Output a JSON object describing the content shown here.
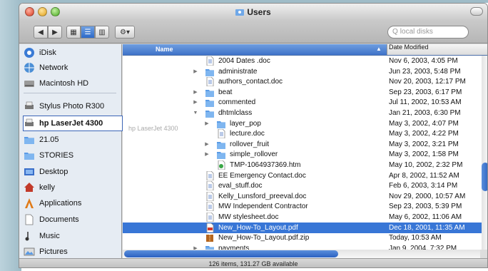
{
  "window": {
    "title": "Users",
    "status_text": "126 items, 131.27 GB available"
  },
  "toolbar": {
    "search_placeholder": "local disks",
    "action_label": "⚙▾"
  },
  "sidebar": {
    "items": [
      {
        "label": "iDisk",
        "icon": "idisk-icon"
      },
      {
        "label": "Network",
        "icon": "network-icon"
      },
      {
        "label": "Macintosh HD",
        "icon": "harddisk-icon"
      },
      {
        "label": "Stylus Photo R300",
        "icon": "printer-icon"
      },
      {
        "label": "hp LaserJet 4300",
        "icon": "printer-icon",
        "selected": true
      },
      {
        "label": "21.05",
        "icon": "folder-icon"
      },
      {
        "label": "STORIES",
        "icon": "folder-icon"
      },
      {
        "label": "Desktop",
        "icon": "desktop-icon"
      },
      {
        "label": "kelly",
        "icon": "home-icon"
      },
      {
        "label": "Applications",
        "icon": "applications-icon"
      },
      {
        "label": "Documents",
        "icon": "documents-icon"
      },
      {
        "label": "Music",
        "icon": "music-icon"
      },
      {
        "label": "Pictures",
        "icon": "pictures-icon"
      }
    ],
    "drag_ghost": "hp LaserJet 4300"
  },
  "list": {
    "headers": {
      "name": "Name",
      "date": "Date Modified"
    },
    "rows": [
      {
        "name": "2004 Dates .doc",
        "date": "Nov 6, 2003, 4:05 PM",
        "kind": "doc",
        "indent": 0,
        "tri": ""
      },
      {
        "name": "administrate",
        "date": "Jun 23, 2003, 5:48 PM",
        "kind": "folder",
        "indent": 0,
        "tri": "▶"
      },
      {
        "name": "authors_contact.doc",
        "date": "Nov 20, 2003, 12:17 PM",
        "kind": "doc",
        "indent": 0,
        "tri": ""
      },
      {
        "name": "beat",
        "date": "Sep 23, 2003, 6:17 PM",
        "kind": "folder",
        "indent": 0,
        "tri": "▶"
      },
      {
        "name": "commented",
        "date": "Jul 11, 2002, 10:53 AM",
        "kind": "folder",
        "indent": 0,
        "tri": "▶"
      },
      {
        "name": "dhtmlclass",
        "date": "Jan 21, 2003, 6:30 PM",
        "kind": "folder",
        "indent": 0,
        "tri": "▼"
      },
      {
        "name": "layer_pop",
        "date": "May 3, 2002, 4:07 PM",
        "kind": "folder",
        "indent": 1,
        "tri": "▶"
      },
      {
        "name": "lecture.doc",
        "date": "May 3, 2002, 4:22 PM",
        "kind": "doc",
        "indent": 1,
        "tri": ""
      },
      {
        "name": "rollover_fruit",
        "date": "May 3, 2002, 3:21 PM",
        "kind": "folder",
        "indent": 1,
        "tri": "▶"
      },
      {
        "name": "simple_rollover",
        "date": "May 3, 2002, 1:58 PM",
        "kind": "folder",
        "indent": 1,
        "tri": "▶"
      },
      {
        "name": "TMP-1064937369.htm",
        "date": "May 10, 2002, 2:32 PM",
        "kind": "htm",
        "indent": 1,
        "tri": ""
      },
      {
        "name": "EE Emergency Contact.doc",
        "date": "Apr 8, 2002, 11:52 AM",
        "kind": "doc",
        "indent": 0,
        "tri": ""
      },
      {
        "name": "eval_stuff.doc",
        "date": "Feb 6, 2003, 3:14 PM",
        "kind": "doc",
        "indent": 0,
        "tri": ""
      },
      {
        "name": "Kelly_Lunsford_preeval.doc",
        "date": "Nov 29, 2000, 10:57 AM",
        "kind": "doc",
        "indent": 0,
        "tri": ""
      },
      {
        "name": "MW Independent Contractor",
        "date": "Sep 23, 2003, 5:39 PM",
        "kind": "doc",
        "indent": 0,
        "tri": ""
      },
      {
        "name": "MW stylesheet.doc",
        "date": "May 6, 2002, 11:06 AM",
        "kind": "doc",
        "indent": 0,
        "tri": ""
      },
      {
        "name": "New_How-To_Layout.pdf",
        "date": "Dec 18, 2001, 11:35 AM",
        "kind": "pdf",
        "indent": 0,
        "tri": "",
        "selected": true
      },
      {
        "name": "New_How-To_Layout.pdf.zip",
        "date": "Today, 10:53 AM",
        "kind": "zip",
        "indent": 0,
        "tri": ""
      },
      {
        "name": "payments",
        "date": "Jan 9, 2004, 7:32 PM",
        "kind": "folder",
        "indent": 0,
        "tri": "▶"
      }
    ]
  },
  "colors": {
    "selection": "#3876d6",
    "sidebar_bg": "#e6ecf3",
    "folder": "#5a9be6"
  }
}
